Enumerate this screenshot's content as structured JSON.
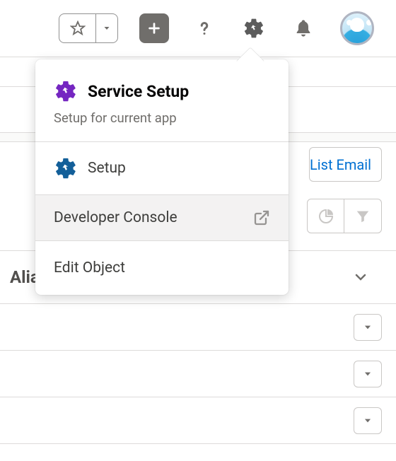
{
  "topbar": {
    "favorites_label": "Favorites",
    "add_label": "Global Actions",
    "help_label": "Help",
    "setup_label": "Setup",
    "notifications_label": "Notifications",
    "profile_label": "View profile"
  },
  "background": {
    "button_list_email": "List Email",
    "pie_icon": "chart",
    "filter_icon": "filter",
    "column_partial": "Alia"
  },
  "setup_menu": {
    "header_title": "Service Setup",
    "header_subtitle": "Setup for current app",
    "items": [
      {
        "label": "Setup",
        "icon": "gear-bolt",
        "external": false,
        "state": ""
      },
      {
        "label": "Developer Console",
        "icon": "",
        "external": true,
        "state": "hover"
      },
      {
        "label": "Edit Object",
        "icon": "",
        "external": false,
        "state": ""
      }
    ]
  }
}
